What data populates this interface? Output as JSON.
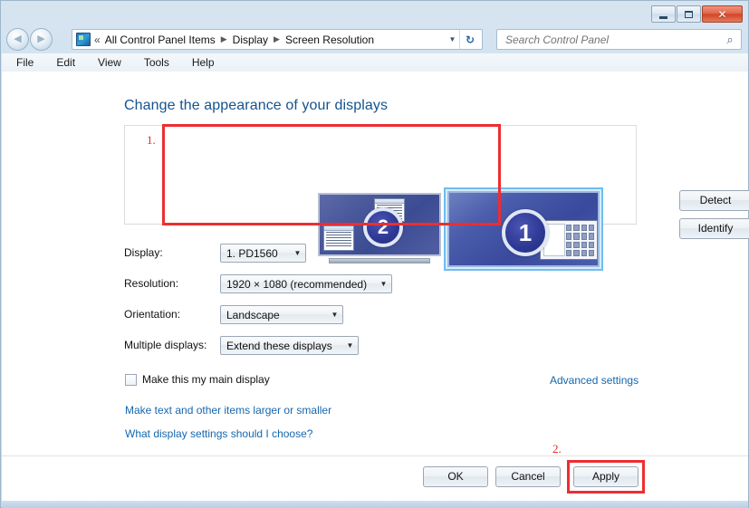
{
  "window": {
    "controls": {
      "minimize": "minimize-button",
      "maximize": "maximize-button",
      "close_label": "✕"
    }
  },
  "nav": {
    "back_glyph": "◀",
    "forward_glyph": "▶",
    "double_chevron": "«",
    "breadcrumbs": [
      "All Control Panel Items",
      "Display",
      "Screen Resolution"
    ],
    "separator": "▶",
    "dropdown_caret": "▼",
    "refresh_glyph": "↻"
  },
  "search": {
    "placeholder": "Search Control Panel",
    "icon_glyph": "⌕"
  },
  "menubar": {
    "items": [
      "File",
      "Edit",
      "View",
      "Tools",
      "Help"
    ]
  },
  "main": {
    "heading": "Change the appearance of your displays",
    "preview": {
      "monitors": [
        {
          "number": "2",
          "selected": false
        },
        {
          "number": "1",
          "selected": true
        }
      ],
      "detect_label": "Detect",
      "identify_label": "Identify"
    },
    "fields": [
      {
        "label": "Display:",
        "value": "1. PD1560"
      },
      {
        "label": "Resolution:",
        "value": "1920 × 1080 (recommended)"
      },
      {
        "label": "Orientation:",
        "value": "Landscape"
      },
      {
        "label": "Multiple displays:",
        "value": "Extend these displays"
      }
    ],
    "combo_caret": "▼",
    "checkbox": {
      "label": "Make this my main display",
      "checked": false
    },
    "advanced_settings_link": "Advanced settings",
    "links": [
      "Make text and other items larger or smaller",
      "What display settings should I choose?"
    ]
  },
  "footer": {
    "ok_label": "OK",
    "cancel_label": "Cancel",
    "apply_label": "Apply"
  },
  "annotations": {
    "step1": "1.",
    "step2": "2.",
    "color": "#ee2d31"
  }
}
